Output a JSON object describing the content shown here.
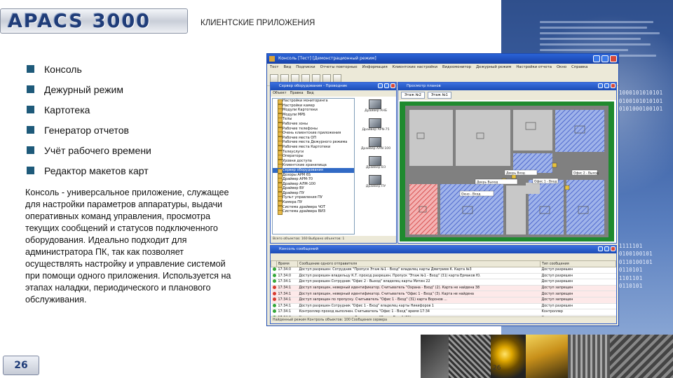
{
  "logo": {
    "text": "APACS",
    "number": "3000"
  },
  "header": {
    "title": "КЛИЕНТСКИЕ ПРИЛОЖЕНИЯ"
  },
  "bullets": [
    "Консоль",
    "Дежурный режим",
    "Картотека",
    "Генератор отчетов",
    "Учёт рабочего времени",
    "Редактор макетов карт"
  ],
  "description": "Консоль - универсальное приложение, служащее для настройки параметров аппаратуры, выдачи оперативных команд управления, просмотра текущих сообщений и статусов подключенного оборудования. Идеально подходит для администратора ПК, так как позволяет осуществлять настройку и управление системой при помощи одного приложения. Используется на этапах наладки, периодического и планового обслуживания.",
  "page_number": "26",
  "small_page_number": "26",
  "binary_lines": [
    "01000101010101",
    "10100101010101",
    "10101000100101",
    "",
    "",
    "",
    "",
    "",
    "",
    "",
    "",
    "",
    "",
    "",
    "",
    "",
    "",
    "",
    "",
    "01111101",
    "10100100101",
    "10110100101",
    "10110101",
    "01101101",
    "10110101"
  ],
  "screenshot": {
    "window_title": "Консоль [Тест] [Демонстрационный режим]",
    "menu": [
      "Тест",
      "Вид",
      "Подписки",
      "Отчеты повторные",
      "Информация",
      "Клиентские настройки",
      "Видеомонитор",
      "Дежурный режим",
      "Настройки отчета",
      "Окно",
      "Справка"
    ],
    "equipment_panel": {
      "title": "Сервер оборудования - Проводник",
      "tabs": [
        "Объект",
        "Правка",
        "Вид"
      ],
      "tree": [
        "Настройки мониторинга",
        "Настройки камер",
        "Модули Картотеки",
        "Модули МРБ",
        "Телы",
        "Рабочие зоны",
        "Рабочие телефоны",
        "Очень клиентские приложения",
        "Рабочие места ОП",
        "Рабочие места Дежурного режима",
        "Рабочие места Картотеки",
        "Телеуслуги",
        "Операторы",
        "Уровни доступа",
        "Клиентские хранилища",
        "Сервер оборудования",
        "Дозоры АРМ 6S",
        "Драйвер АРМ-70",
        "Драйвер АЛМ-100",
        "Драйвер ВУ",
        "Драйвер ПУ",
        "Пульт управления ПУ",
        "Камера ПУ",
        "Система драйвера ЧОТ",
        "Система драйвера ВИЗ"
      ],
      "devices": [
        "Драйвер АНБ",
        "Драйвер APN-75",
        "Драйвер AAN 100",
        "Драйвер ВЗ",
        "Драйвер ПУ"
      ],
      "status": "Всего объектов: 160    Выбрано объектов: 1"
    },
    "plan_panel": {
      "title": "Просмотр планов",
      "tabs": [
        "Этаж №2",
        "Этаж №1"
      ],
      "labels": [
        "Дверь Выход",
        "Дверь Вход",
        "Офис 1 - Вход",
        "Окно - Вход",
        "Офис 2 - Выход"
      ]
    },
    "messages_panel": {
      "title": "Консоль сообщений",
      "columns": [
        "Время",
        "Сообщение одного отправителя",
        "Тип сообщения"
      ],
      "rows": [
        {
          "time": "17:34:0",
          "msg": "Доступ разрешен: Сотрудник \"Пропуск Этаж №1 - Вход\" владелец карты Дмитриев К. Карта №3",
          "type": "Доступ разрешен",
          "level": "g",
          "alt": false
        },
        {
          "time": "17:34:0",
          "msg": "Доступ разрешен владельцу К.Т. проход разрешен. Пропуск \"Этаж №1 - Вход\" (31) карта Ермаков Ю.",
          "type": "Доступ разрешен",
          "level": "g",
          "alt": false
        },
        {
          "time": "17:34:1",
          "msg": "Доступ разрешен Сотрудник \"Офис 2 - Выход\" владелец карты Митин 22",
          "type": "Доступ разрешен",
          "level": "g",
          "alt": false
        },
        {
          "time": "17:34:1",
          "msg": "Доступ запрещен, неверный идентификатор. Считыватель \"Охрана - Вход\" (2). Карта не найдена 38",
          "type": "Доступ запрещен",
          "level": "r",
          "alt": true
        },
        {
          "time": "17:34:1",
          "msg": "Доступ запрещен, неверный идентификатор. Считыватель \"Офис 1 - Вход\" (3). Карта не найдена",
          "type": "Доступ запрещен",
          "level": "r",
          "alt": true
        },
        {
          "time": "17:34:1",
          "msg": "Доступ запрещен по пропуску. Считыватель \"Офис 1 - Вход\" (31) карта Воронов ...",
          "type": "Доступ запрещен",
          "level": "r",
          "alt": true
        },
        {
          "time": "17:34:1",
          "msg": "Доступ разрешен Сотрудник \"Офис 1 - Вход\" владелец карты Никифоров 1",
          "type": "Доступ разрешен",
          "level": "g",
          "alt": false
        },
        {
          "time": "17:34:1",
          "msg": "Контроллер проход выполнен. Считыватель \"Офис 1 - Вход\" время 17:34",
          "type": "Контроллер",
          "level": "g",
          "alt": false
        },
        {
          "time": "17:34:2",
          "msg": "Контроллер проход выполнен. Считыватель \"Окно - Вход\" (31)",
          "type": "Контроллер",
          "level": "g",
          "alt": false
        },
        {
          "time": "17:34:2",
          "msg": "Доступ разрешен Сотрудник \"Окно - Вход\" владелец карты Д. П. карта 16",
          "type": "Доступ разрешен",
          "level": "g",
          "alt": false
        }
      ],
      "status": "Найденный режим Контроль объектов: 100     Сообщения сервера"
    }
  },
  "colors": {
    "accent": "#1e5a7a",
    "brand": "#1f3c78",
    "panel_blue": "#3e63a6"
  }
}
